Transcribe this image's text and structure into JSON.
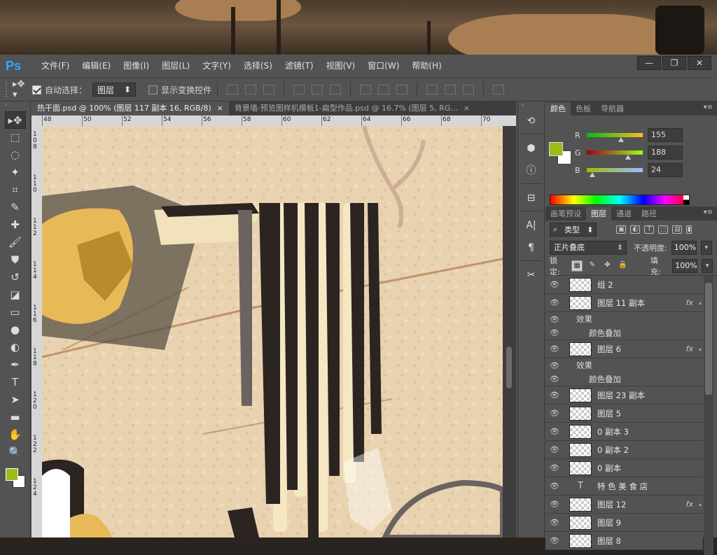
{
  "app": {
    "logo": "Ps"
  },
  "menu": [
    "文件(F)",
    "编辑(E)",
    "图像(I)",
    "图层(L)",
    "文字(Y)",
    "选择(S)",
    "滤镜(T)",
    "视图(V)",
    "窗口(W)",
    "帮助(H)"
  ],
  "window_buttons": {
    "minimize": "—",
    "restore": "❐",
    "close": "✕"
  },
  "options": {
    "auto_select_label": "自动选择：",
    "auto_select_checked": true,
    "auto_select_target": "图层",
    "show_transform_label": "显示变换控件",
    "show_transform_checked": false
  },
  "tabs": [
    {
      "title": "热干面.psd @ 100% (图层 117 副本 16, RGB/8)",
      "close": "×",
      "active": true
    },
    {
      "title": "背景墙-预览图样机模板1-扁型作品.psd @ 16.7% (图层 5, RG...",
      "close": "×",
      "active": false
    }
  ],
  "ruler": {
    "h_ticks": [
      "48",
      "50",
      "52",
      "54",
      "56",
      "58",
      "60",
      "62",
      "64",
      "66",
      "68",
      "70"
    ],
    "v_ticks": [
      "108",
      "110",
      "112",
      "114",
      "116",
      "118",
      "120",
      "122",
      "124"
    ]
  },
  "color_panel": {
    "tabs": [
      "颜色",
      "色板",
      "导航器"
    ],
    "r": {
      "label": "R",
      "value": "155"
    },
    "g": {
      "label": "G",
      "value": "188"
    },
    "b": {
      "label": "B",
      "value": "24"
    },
    "foreground_color": "#9bbc18"
  },
  "layers_panel": {
    "tabs": [
      "画笔预设",
      "图层",
      "通道",
      "路径"
    ],
    "filter_kind": "类型",
    "blend_mode": "正片叠底",
    "opacity_label": "不透明度:",
    "opacity": "100%",
    "lock_label": "锁定:",
    "fill_label": "填充:",
    "fill": "100%",
    "layers": [
      {
        "name": "组 2",
        "type": "group",
        "fx": ""
      },
      {
        "name": "图层 11 副本",
        "type": "pixel",
        "fx": "fx",
        "effects_label": "效果",
        "effect": "颜色叠加"
      },
      {
        "name": "图层 6",
        "type": "pixel",
        "fx": "fx",
        "effects_label": "效果",
        "effect": "颜色叠加"
      },
      {
        "name": "图层 23 副本",
        "type": "pixel",
        "fx": ""
      },
      {
        "name": "图层 5",
        "type": "pixel",
        "fx": ""
      },
      {
        "name": "0 副本 3",
        "type": "pixel",
        "fx": ""
      },
      {
        "name": "0 副本 2",
        "type": "pixel",
        "fx": ""
      },
      {
        "name": "0 副本",
        "type": "pixel",
        "fx": ""
      },
      {
        "name": "特 色 美 食 店",
        "type": "text",
        "fx": ""
      },
      {
        "name": "图层 12",
        "type": "pixel",
        "fx": "fx"
      },
      {
        "name": "图层 9",
        "type": "pixel",
        "fx": ""
      },
      {
        "name": "图层 8",
        "type": "pixel",
        "fx": ""
      }
    ]
  },
  "colors": {
    "accent": "#31a8ff",
    "foreground": "#9bbc18",
    "background": "#ffffff",
    "canvas": "#e8d2b0"
  }
}
